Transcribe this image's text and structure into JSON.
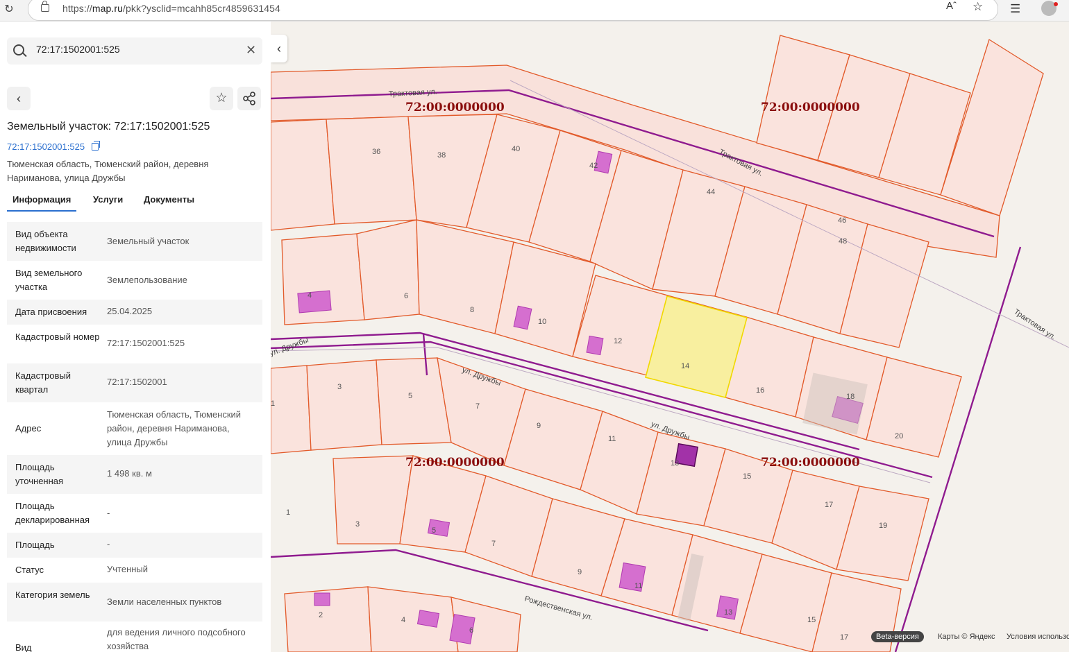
{
  "browser": {
    "url_prefix": "https://",
    "url_host": "map.ru",
    "url_path": "/pkk?ysclid=mcahh85cr4859631454"
  },
  "search": {
    "value": "72:17:1502001:525"
  },
  "header": {
    "title": "Земельный участок: 72:17:1502001:525",
    "cad_link": "72:17:1502001:525",
    "address": "Тюменская область, Тюменский район, деревня Нариманова, улица Дружбы"
  },
  "tabs": [
    "Информация",
    "Услуги",
    "Документы"
  ],
  "rows": [
    {
      "k": "Вид объекта недвижимости",
      "v": "Земельный участок"
    },
    {
      "k": "Вид земельного участка",
      "v": "Землепользование"
    },
    {
      "k": "Дата присвоения",
      "v": "25.04.2025"
    },
    {
      "k": "Кадастровый номер",
      "v": "72:17:1502001:525"
    },
    {
      "k": "Кадастровый квартал",
      "v": "72:17:1502001"
    },
    {
      "k": "Адрес",
      "v": "Тюменская область, Тюменский район, деревня Нариманова, улица Дружбы"
    },
    {
      "k": "Площадь уточненная",
      "v": "1 498 кв. м"
    },
    {
      "k": "Площадь декларированная",
      "v": "-"
    },
    {
      "k": "Площадь",
      "v": "-"
    },
    {
      "k": "Статус",
      "v": "Учтенный"
    },
    {
      "k": "Категория земель",
      "v": "Земли населенных пунктов"
    },
    {
      "k": "Вид",
      "v": "для ведения личного подсобного хозяйства"
    }
  ],
  "map": {
    "cad_labels": [
      "72:00:0000000",
      "72:00:0000000",
      "72:00:0000000",
      "72:00:0000000"
    ],
    "streets": [
      "Трактовая ул.",
      "Трактовая ул.",
      "Трактовая ул.",
      "ул. Дружбы",
      "ул. Дружбы",
      "ул. Дружбы",
      "Рождественская ул."
    ],
    "parcel_numbers": [
      "36",
      "38",
      "40",
      "42",
      "44",
      "46",
      "48",
      "4",
      "6",
      "8",
      "10",
      "12",
      "14",
      "16",
      "18",
      "20",
      "1",
      "3",
      "5",
      "7",
      "9",
      "11",
      "13",
      "15",
      "17",
      "19",
      "1",
      "3",
      "5",
      "7",
      "9",
      "11",
      "13",
      "15",
      "17",
      "2",
      "4",
      "6"
    ],
    "beta": "Beta-версия",
    "attribution": "Карты © Яндекс",
    "terms": "Условия использования"
  }
}
